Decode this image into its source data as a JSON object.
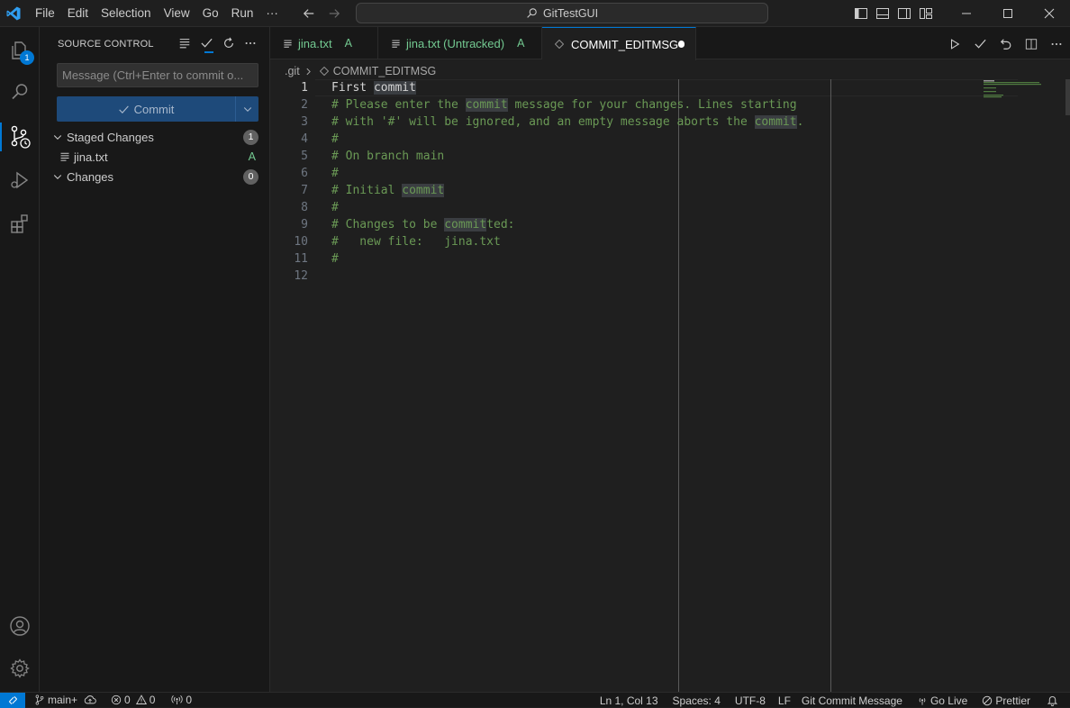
{
  "titlebar": {
    "menu": [
      "File",
      "Edit",
      "Selection",
      "View",
      "Go",
      "Run",
      "···"
    ],
    "search": "GitTestGUI"
  },
  "activity": {
    "explorer_badge": "1"
  },
  "sidebar": {
    "title": "SOURCE CONTROL",
    "message_placeholder": "Message (Ctrl+Enter to commit o...",
    "commit_label": "Commit",
    "staged_label": "Staged Changes",
    "staged_count": "1",
    "staged_files": [
      {
        "name": "jina.txt",
        "status": "A"
      }
    ],
    "changes_label": "Changes",
    "changes_count": "0"
  },
  "tabs": [
    {
      "label": "jina.txt",
      "status": "A"
    },
    {
      "label": "jina.txt (Untracked)",
      "status": "A"
    },
    {
      "label": "COMMIT_EDITMSG",
      "status": ""
    }
  ],
  "breadcrumb": {
    "folder": ".git",
    "file": "COMMIT_EDITMSG"
  },
  "editor": {
    "lines": [
      "First commit",
      "# Please enter the commit message for your changes. Lines starting",
      "# with '#' will be ignored, and an empty message aborts the commit.",
      "#",
      "# On branch main",
      "#",
      "# Initial commit",
      "#",
      "# Changes to be committed:",
      "#   new file:   jina.txt",
      "#",
      ""
    ]
  },
  "statusbar": {
    "branch": "main+",
    "errors": "0",
    "warnings": "0",
    "ports": "0",
    "position": "Ln 1, Col 13",
    "spaces": "Spaces: 4",
    "encoding": "UTF-8",
    "eol": "LF",
    "language": "Git Commit Message",
    "golive": "Go Live",
    "prettier": "Prettier"
  },
  "colors": {
    "accent": "#0078d4",
    "added": "#73c991",
    "comment": "#6a9955"
  }
}
